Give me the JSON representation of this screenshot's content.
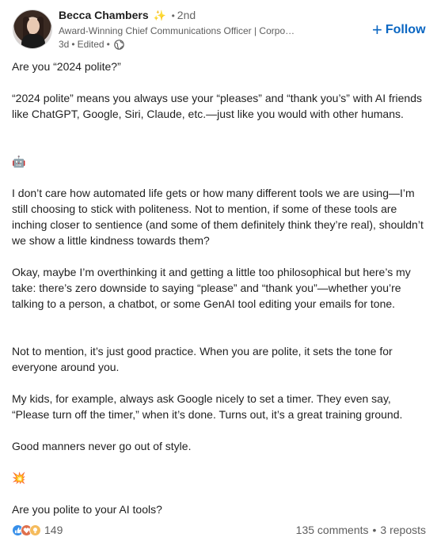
{
  "author": {
    "name": "Becca Chambers",
    "sparkle_icon": "✨",
    "degree": "2nd",
    "headline": "Award-Winning Chief Communications Officer | Corpo…",
    "time": "3d",
    "edited": "Edited",
    "visibility_icon": "globe-icon"
  },
  "follow": {
    "label": "Follow",
    "icon": "+"
  },
  "post": {
    "paragraphs": [
      "Are you “2024 polite?”",
      "“2024 polite” means you always use your “pleases” and “thank you’s” with AI friends like ChatGPT, Google, Siri, Claude, etc.—just like you would with other humans.",
      "🤖",
      "I don’t care how automated life gets or how many different tools we are using—I’m still choosing to stick with politeness. Not to mention, if some of these tools are inching closer to sentience (and some of them definitely think they’re real), shouldn’t we show a little kindness towards them?",
      "Okay, maybe I’m overthinking it and getting a little too philosophical but here’s my take: there’s zero downside to saying “please” and “thank you”—whether you’re talking to a person, a chatbot, or some GenAI tool editing your emails for tone.",
      "Not to mention, it’s just good practice. When you are polite, it sets the tone for everyone around you.",
      "My kids, for example, always ask Google nicely to set a timer. They even say, “Please turn off the timer,” when it’s done. Turns out, it’s a great training ground.",
      "Good manners never go out of style.",
      "💥",
      "Are you polite to your AI tools?"
    ]
  },
  "footer": {
    "reaction_count": "149",
    "comments": "135 comments",
    "reposts": "3 reposts"
  },
  "colors": {
    "accent": "#0a66c2",
    "muted": "#5e5e5e"
  }
}
